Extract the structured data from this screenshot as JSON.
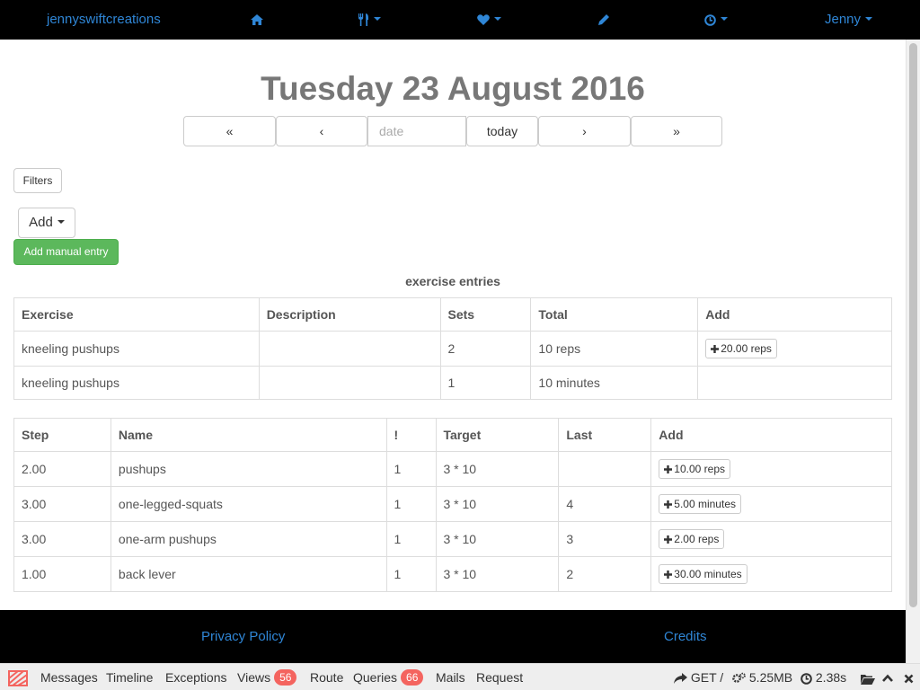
{
  "navbar": {
    "brand": "jennyswiftcreations",
    "home_icon": "home-icon",
    "food_icon": "cutlery-icon",
    "health_icon": "heart-icon",
    "journal_icon": "pencil-icon",
    "timer_icon": "clock-icon",
    "user": "Jenny"
  },
  "date_header": {
    "title": "Tuesday 23 August 2016",
    "first_label": "«",
    "prev_label": "‹",
    "date_placeholder": "date",
    "today_label": "today",
    "next_label": "›",
    "last_label": "»"
  },
  "actions": {
    "filters_label": "Filters",
    "add_label": "Add",
    "add_manual_label": "Add manual entry"
  },
  "entries": {
    "title": "exercise entries",
    "columns": [
      "Exercise",
      "Description",
      "Sets",
      "Total",
      "Add"
    ],
    "rows": [
      {
        "exercise": "kneeling pushups",
        "description": "",
        "sets": "2",
        "total": "10 reps",
        "add": "20.00 reps"
      },
      {
        "exercise": "kneeling pushups",
        "description": "",
        "sets": "1",
        "total": "10 minutes",
        "add": ""
      }
    ]
  },
  "series": {
    "columns": [
      "Step",
      "Name",
      "!",
      "Target",
      "Last",
      "Add"
    ],
    "rows": [
      {
        "step": "2.00",
        "name": "pushups",
        "priority": "1",
        "target": "3 * 10",
        "last": "",
        "add": "10.00 reps"
      },
      {
        "step": "3.00",
        "name": "one-legged-squats",
        "priority": "1",
        "target": "3 * 10",
        "last": "4",
        "add": "5.00 minutes"
      },
      {
        "step": "3.00",
        "name": "one-arm pushups",
        "priority": "1",
        "target": "3 * 10",
        "last": "3",
        "add": "2.00 reps"
      },
      {
        "step": "1.00",
        "name": "back lever",
        "priority": "1",
        "target": "3 * 10",
        "last": "2",
        "add": "30.00 minutes"
      }
    ]
  },
  "footer": {
    "privacy": "Privacy Policy",
    "credits": "Credits"
  },
  "debugbar": {
    "messages": "Messages",
    "timeline": "Timeline",
    "exceptions": "Exceptions",
    "views": "Views",
    "views_count": "56",
    "route": "Route",
    "queries": "Queries",
    "queries_count": "66",
    "mails": "Mails",
    "request": "Request",
    "method": "GET /",
    "memory": "5.25MB",
    "time": "2.38s"
  },
  "colors": {
    "link": "#2f86d6",
    "success": "#5cb85c",
    "badge": "#f4645f",
    "navbar": "#000000"
  }
}
